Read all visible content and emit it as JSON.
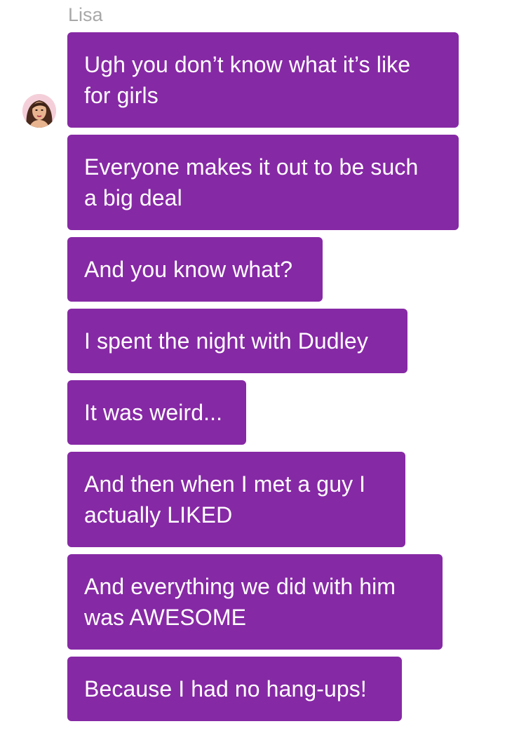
{
  "conversation": {
    "sender_name": "Lisa",
    "bubble_color": "#8629a5",
    "avatar_icon": "user-avatar-woman-icon",
    "messages": [
      {
        "text": "Ugh you don’t know what it’s like\nfor girls"
      },
      {
        "text": "Everyone makes it out to be such\na big deal"
      },
      {
        "text": "And you know what?"
      },
      {
        "text": "I spent the night with Dudley"
      },
      {
        "text": "It was weird..."
      },
      {
        "text": "And then when I met a guy I\nactually LIKED"
      },
      {
        "text": "And everything we did with him\nwas AWESOME"
      },
      {
        "text": "Because I had no hang-ups!"
      }
    ]
  }
}
